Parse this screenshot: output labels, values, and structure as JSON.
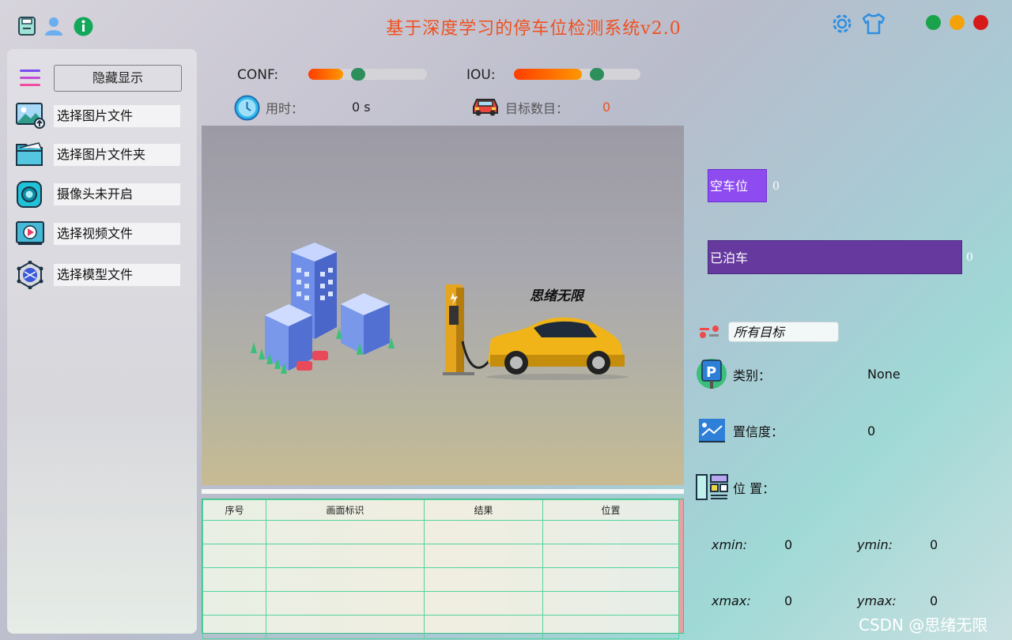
{
  "title": "基于深度学习的停车位检测系统v2.0",
  "titlebar_icons": [
    "save-icon",
    "user-icon",
    "info-icon"
  ],
  "window_controls": [
    {
      "name": "maximize",
      "color": "#1aa34a"
    },
    {
      "name": "minimize",
      "color": "#f4a20c"
    },
    {
      "name": "close",
      "color": "#d61a1a"
    }
  ],
  "sidebar": {
    "toggle_label": "隐藏显示",
    "items": [
      {
        "label": "选择图片文件",
        "icon": "image-upload-icon"
      },
      {
        "label": "选择图片文件夹",
        "icon": "folder-icon"
      },
      {
        "label": "摄像头未开启",
        "icon": "camera-icon"
      },
      {
        "label": "选择视频文件",
        "icon": "video-icon"
      },
      {
        "label": "选择模型文件",
        "icon": "model-icon"
      }
    ]
  },
  "controls": {
    "conf_label": "CONF:",
    "conf_value": 0.25,
    "iou_label": "IOU:",
    "iou_value": 0.5,
    "time_label": "用时：",
    "time_value": "0 s",
    "target_count_label": "目标数目：",
    "target_count_value": "0"
  },
  "display": {
    "watermark_text": "思绪无限"
  },
  "table": {
    "columns": [
      "序号",
      "画面标识",
      "结果",
      "位置"
    ],
    "rows": [
      [
        "",
        "",
        "",
        ""
      ],
      [
        "",
        "",
        "",
        ""
      ],
      [
        "",
        "",
        "",
        ""
      ],
      [
        "",
        "",
        "",
        ""
      ],
      [
        "",
        "",
        "",
        ""
      ]
    ]
  },
  "stats": {
    "empty": {
      "label": "空车位",
      "value": "0",
      "color": "#8e4cf0"
    },
    "occupied": {
      "label": "已泊车",
      "value": "0",
      "color": "#66399e"
    }
  },
  "detail": {
    "target_select": "所有目标",
    "class_label": "类别：",
    "class_value": "None",
    "conf_label": "置信度：",
    "conf_value": "0",
    "pos_label": "位 置：",
    "xmin_label": "xmin:",
    "xmin_value": "0",
    "ymin_label": "ymin:",
    "ymin_value": "0",
    "xmax_label": "xmax:",
    "xmax_value": "0",
    "ymax_label": "ymax:",
    "ymax_value": "0"
  },
  "footer_watermark": "CSDN @思绪无限"
}
